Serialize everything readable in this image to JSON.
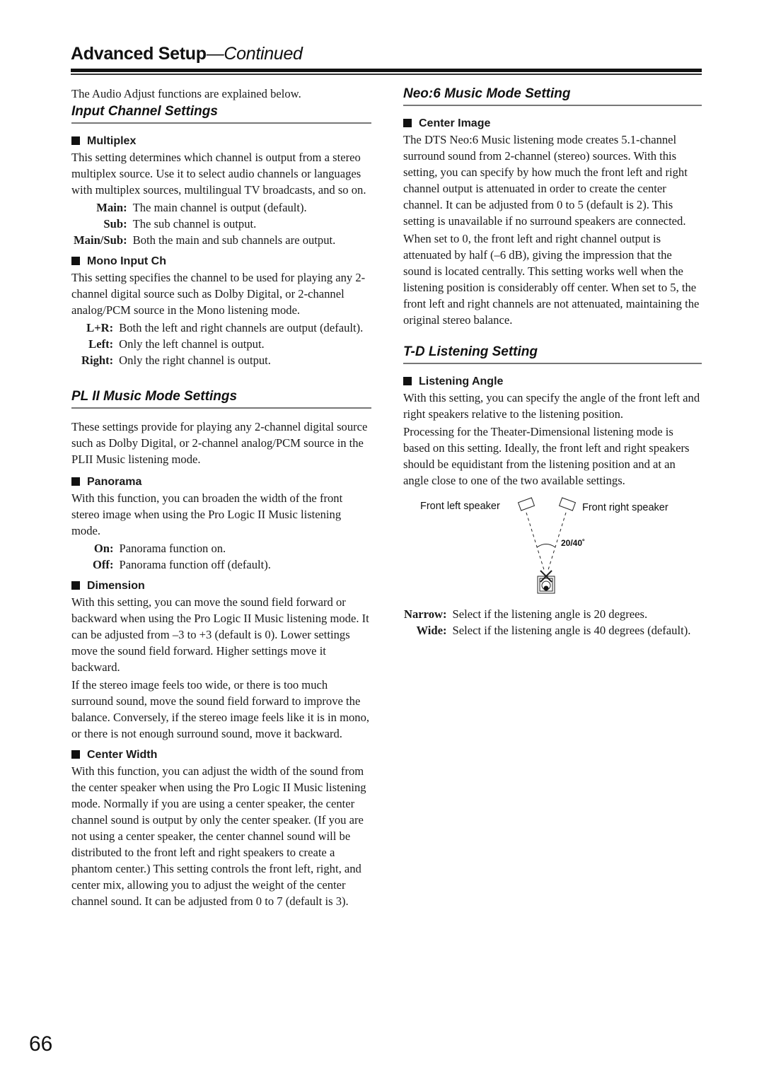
{
  "header": {
    "title_main": "Advanced Setup",
    "title_suffix": "—Continued"
  },
  "left": {
    "intro": "The Audio Adjust functions are explained below.",
    "input_channel": {
      "title": "Input Channel Settings",
      "multiplex": {
        "title": "Multiplex",
        "body": "This setting determines which channel is output from a stereo multiplex source. Use it to select audio channels or languages with multiplex sources, multilingual TV broadcasts, and so on.",
        "options": [
          {
            "term": "Main:",
            "desc": "The main channel is output (default)."
          },
          {
            "term": "Sub:",
            "desc": "The sub channel is output."
          },
          {
            "term": "Main/Sub:",
            "desc": "Both the main and sub channels are output."
          }
        ]
      },
      "mono_input": {
        "title": "Mono Input Ch",
        "body": "This setting specifies the channel to be used for playing any 2-channel digital source such as Dolby Digital, or 2-channel analog/PCM source in the Mono listening mode.",
        "options": [
          {
            "term": "L+R:",
            "desc": "Both the left and right channels are output (default)."
          },
          {
            "term": "Left:",
            "desc": "Only the left channel is output."
          },
          {
            "term": "Right:",
            "desc": "Only the right channel is output."
          }
        ]
      }
    },
    "pl2": {
      "title": "PL II Music Mode Settings",
      "intro": "These settings provide for playing any 2-channel digital source such as Dolby Digital, or 2-channel analog/PCM source in the PLII Music listening mode.",
      "panorama": {
        "title": "Panorama",
        "body": "With this function, you can broaden the width of the front stereo image when using the Pro Logic II Music listening mode.",
        "options": [
          {
            "term": "On:",
            "desc": "Panorama function on."
          },
          {
            "term": "Off:",
            "desc": "Panorama function off (default)."
          }
        ]
      },
      "dimension": {
        "title": "Dimension",
        "body1": "With this setting, you can move the sound field forward or backward when using the Pro Logic II Music listening mode. It can be adjusted from –3 to +3 (default is 0). Lower settings move the sound field forward. Higher settings move it backward.",
        "body2": "If the stereo image feels too wide, or there is too much surround sound, move the sound field forward to improve the balance. Conversely, if the stereo image feels like it is in mono, or there is not enough surround sound, move it backward."
      },
      "center_width": {
        "title": "Center Width",
        "body": "With this function, you can adjust the width of the sound from the center speaker when using the Pro Logic II Music listening mode. Normally if you are using a center speaker, the center channel sound is output by only the center speaker. (If you are not using a center speaker, the center channel sound will be distributed to the front left and right speakers to create a phantom center.) This setting controls the front left, right, and center mix, allowing you to adjust the weight of the center channel sound. It can be adjusted from 0 to 7 (default is 3)."
      }
    }
  },
  "right": {
    "neo6": {
      "title": "Neo:6 Music Mode Setting",
      "center_image": {
        "title": "Center Image",
        "body1": "The DTS Neo:6 Music listening mode creates 5.1-channel surround sound from 2-channel (stereo) sources. With this setting, you can specify by how much the front left and right channel output is attenuated in order to create the center channel. It can be adjusted from 0 to 5 (default is 2). This setting is unavailable if no surround speakers are connected.",
        "body2": "When set to 0, the front left and right channel output is attenuated by half (–6 dB), giving the impression that the sound is located centrally. This setting works well when the listening position is considerably off center. When set to 5, the front left and right channels are not attenuated, maintaining the original stereo balance."
      }
    },
    "td": {
      "title": "T-D Listening Setting",
      "listening_angle": {
        "title": "Listening Angle",
        "body1": "With this setting, you can specify the angle of the front left and right speakers relative to the listening position.",
        "body2": "Processing for the Theater-Dimensional listening mode is based on this setting. Ideally, the front left and right speakers should be equidistant from the listening position and at an angle close to one of the two available settings.",
        "diagram": {
          "left_label": "Front left speaker",
          "right_label": "Front right speaker",
          "angle_label": "20/40˚"
        },
        "options": [
          {
            "term": "Narrow:",
            "desc": "Select if the listening angle is 20 degrees."
          },
          {
            "term": "Wide:",
            "desc": "Select if the listening angle is 40 degrees (default)."
          }
        ]
      }
    }
  },
  "footer": {
    "page_number": "66"
  }
}
